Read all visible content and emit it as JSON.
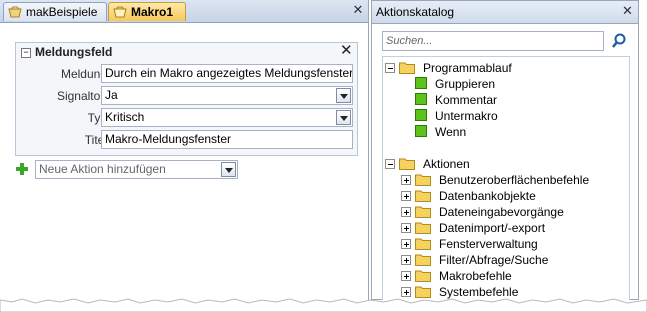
{
  "tabs": [
    {
      "label": "makBeispiele",
      "active": false
    },
    {
      "label": "Makro1",
      "active": true
    }
  ],
  "action_block": {
    "title": "Meldungsfeld",
    "fields": [
      {
        "label": "Meldung",
        "value": "Durch ein Makro angezeigtes Meldungsfenster",
        "dropdown": false
      },
      {
        "label": "Signalton",
        "value": "Ja",
        "dropdown": true
      },
      {
        "label": "Typ",
        "value": "Kritisch",
        "dropdown": true
      },
      {
        "label": "Titel",
        "value": "Makro-Meldungsfenster",
        "dropdown": false
      }
    ]
  },
  "add_action": {
    "placeholder": "Neue Aktion hinzufügen"
  },
  "catalog": {
    "title": "Aktionskatalog",
    "search_placeholder": "Suchen...",
    "groups": [
      {
        "label": "Programmablauf",
        "expanded": true,
        "items": [
          "Gruppieren",
          "Kommentar",
          "Untermakro",
          "Wenn"
        ]
      },
      {
        "label": "Aktionen",
        "expanded": true,
        "items": [
          "Benutzeroberflächenbefehle",
          "Datenbankobjekte",
          "Dateneingabevorgänge",
          "Datenimport/-export",
          "Fensterverwaltung",
          "Filter/Abfrage/Suche",
          "Makrobefehle",
          "Systembefehle"
        ]
      }
    ]
  },
  "colors": {
    "active_tab": "#f7c95a",
    "folder": "#f2c84b",
    "action_icon": "#5ec21a",
    "plus": "#3aa62a"
  }
}
